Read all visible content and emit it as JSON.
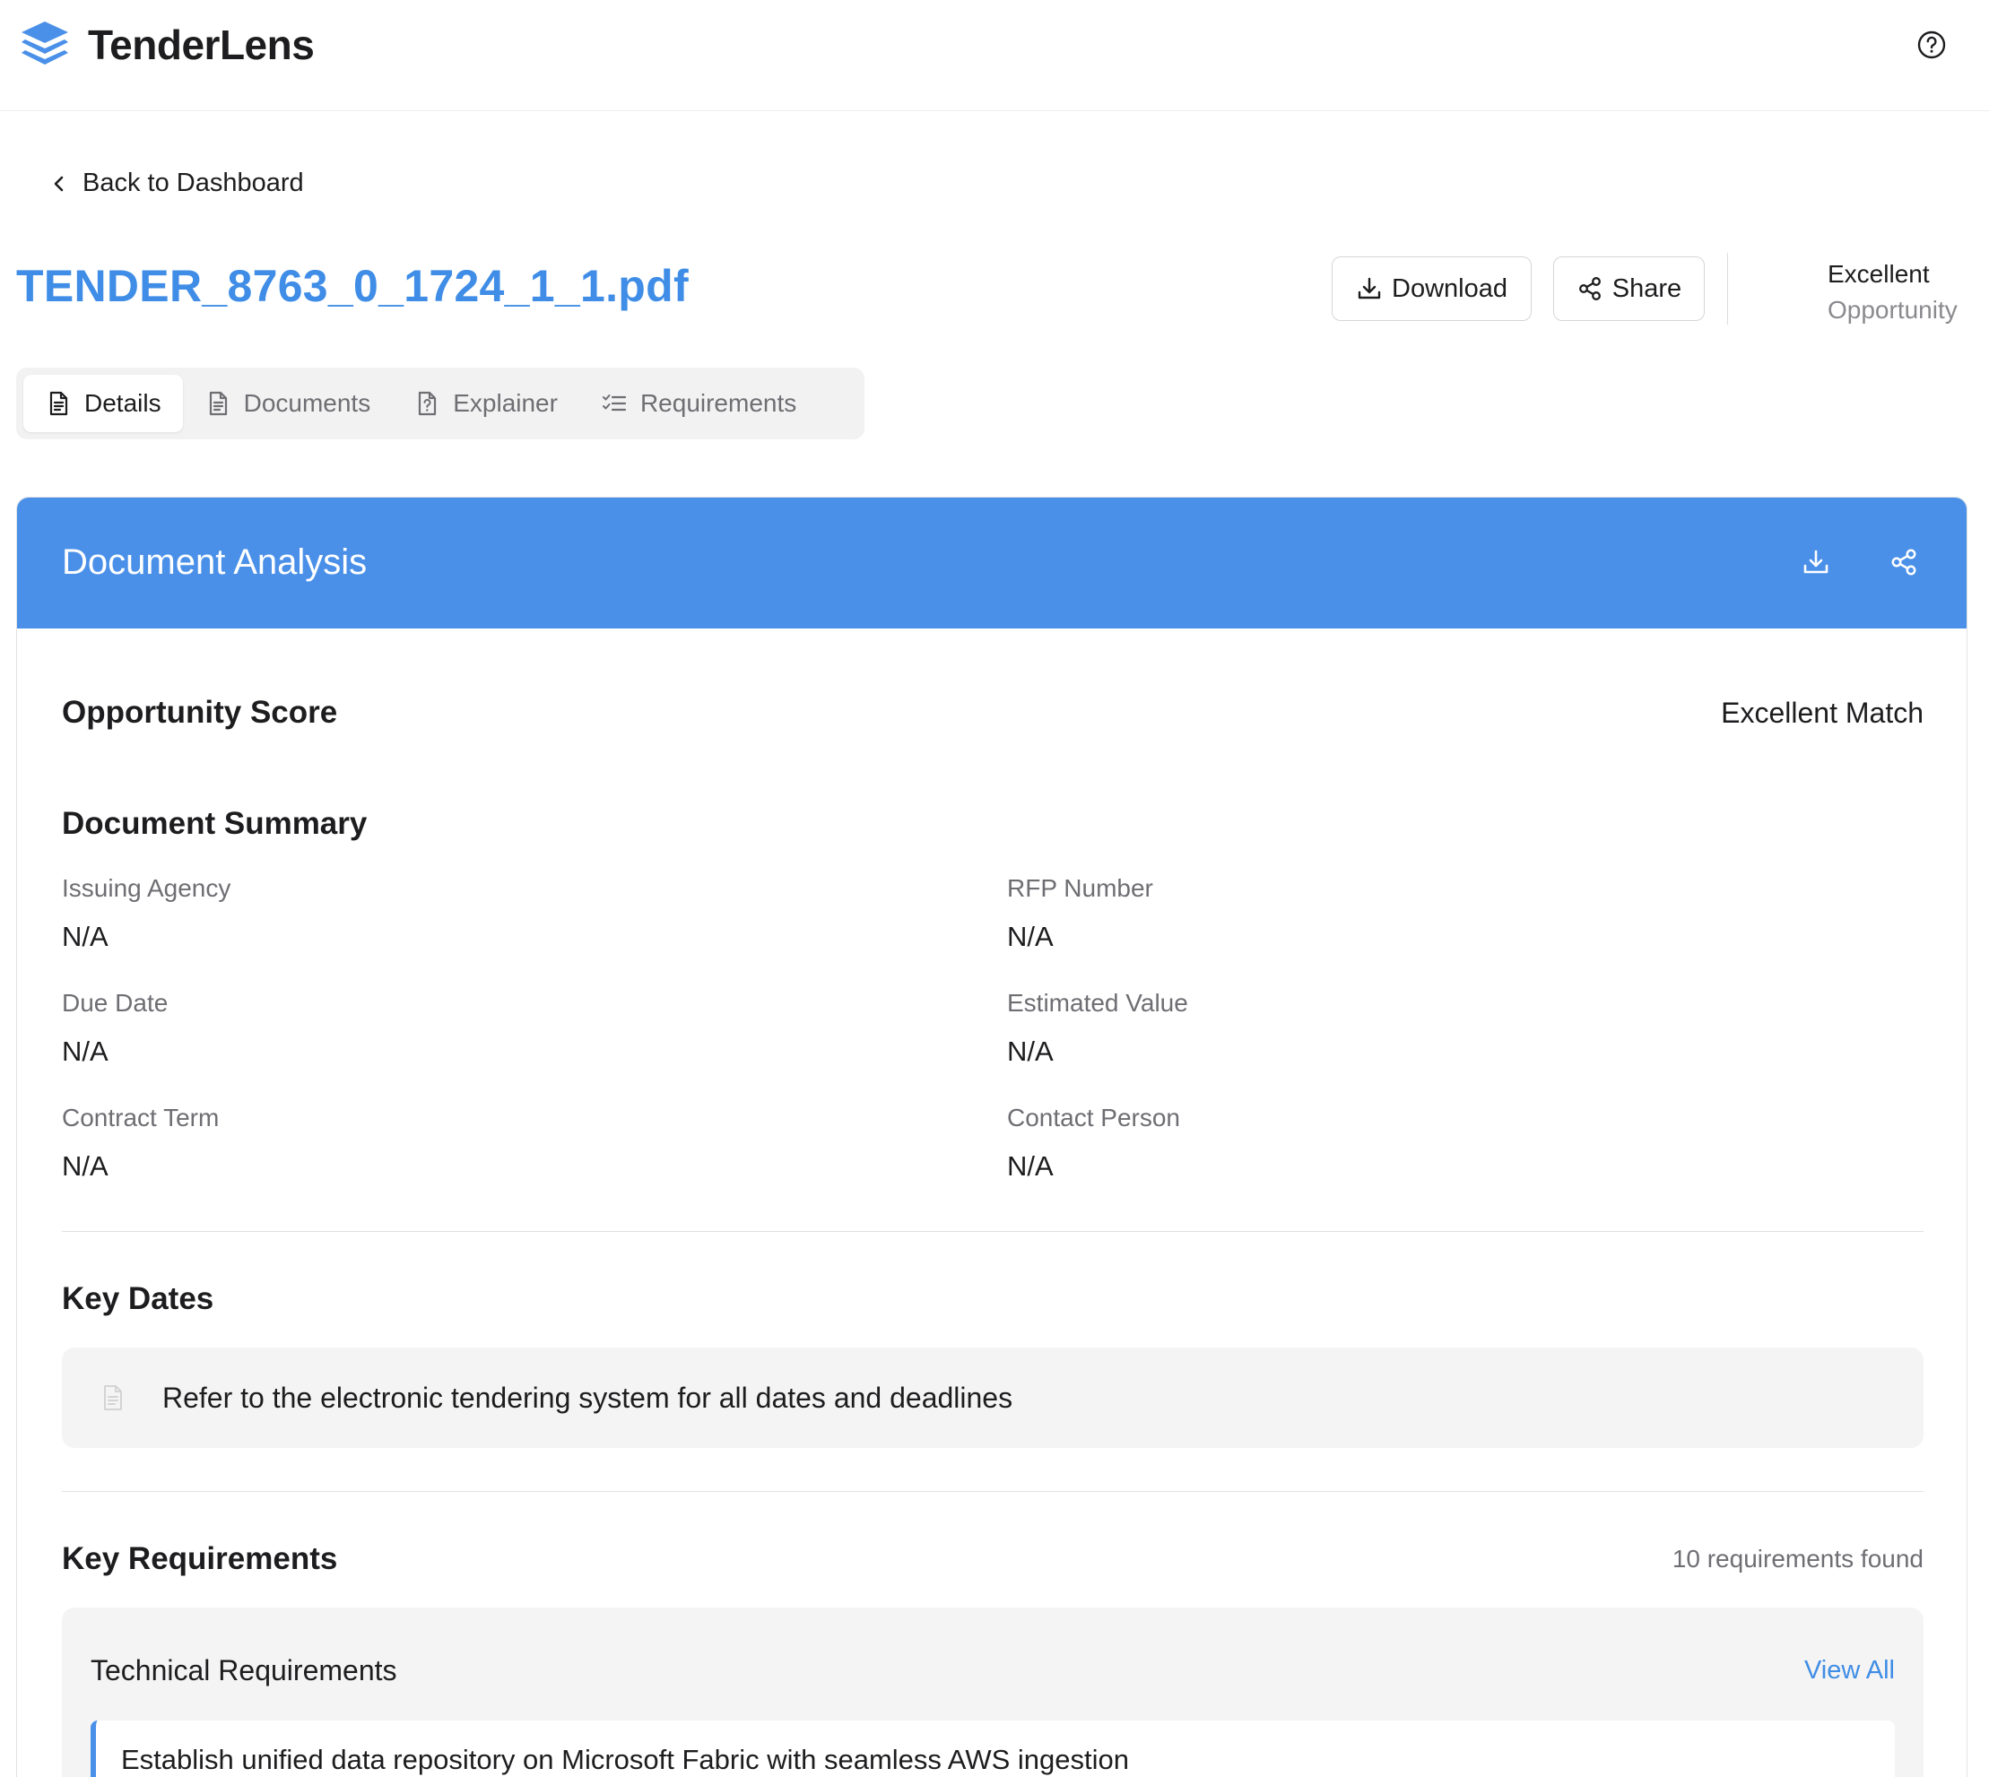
{
  "app": {
    "name": "TenderLens"
  },
  "nav": {
    "back_label": "Back to Dashboard"
  },
  "document": {
    "filename": "TENDER_8763_0_1724_1_1.pdf"
  },
  "actions": {
    "download_label": "Download",
    "share_label": "Share"
  },
  "rating": {
    "line1": "Excellent",
    "line2": "Opportunity"
  },
  "tabs": [
    {
      "label": "Details",
      "icon": "file-text-icon",
      "active": true
    },
    {
      "label": "Documents",
      "icon": "file-icon",
      "active": false
    },
    {
      "label": "Explainer",
      "icon": "file-question-icon",
      "active": false
    },
    {
      "label": "Requirements",
      "icon": "list-checks-icon",
      "active": false
    }
  ],
  "analysis": {
    "title": "Document Analysis",
    "score_title": "Opportunity Score",
    "score_label": "Excellent Match",
    "summary_title": "Document Summary",
    "fields": {
      "issuing_agency": {
        "label": "Issuing Agency",
        "value": "N/A"
      },
      "rfp_number": {
        "label": "RFP Number",
        "value": "N/A"
      },
      "due_date": {
        "label": "Due Date",
        "value": "N/A"
      },
      "estimated_value": {
        "label": "Estimated Value",
        "value": "N/A"
      },
      "contract_term": {
        "label": "Contract Term",
        "value": "N/A"
      },
      "contact_person": {
        "label": "Contact Person",
        "value": "N/A"
      }
    },
    "key_dates_title": "Key Dates",
    "key_dates_note": "Refer to the electronic tendering system for all dates and deadlines",
    "key_requirements_title": "Key Requirements",
    "requirements_count": "10 requirements found",
    "requirement_group": {
      "title": "Technical Requirements",
      "view_all_label": "View All",
      "first_item": "Establish unified data repository on Microsoft Fabric with seamless AWS ingestion"
    }
  },
  "colors": {
    "accent": "#4a90e8",
    "title_blue": "#3f8de6"
  }
}
